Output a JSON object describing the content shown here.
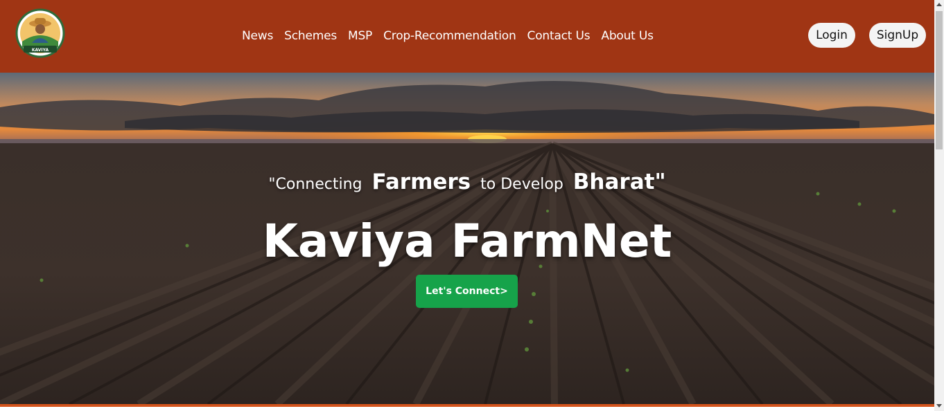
{
  "brand": {
    "logo_text": "KAVIYA"
  },
  "nav": {
    "links": [
      {
        "label": "News"
      },
      {
        "label": "Schemes"
      },
      {
        "label": "MSP"
      },
      {
        "label": "Crop-Recommendation"
      },
      {
        "label": "Contact Us"
      },
      {
        "label": "About Us"
      }
    ],
    "login_label": "Login",
    "signup_label": "SignUp"
  },
  "hero": {
    "tagline_part1": "\"Connecting",
    "tagline_part2": "Farmers",
    "tagline_part3": "to Develop",
    "tagline_part4": "Bharat\"",
    "title": "Kaviya FarmNet",
    "cta_label": "Let's Connect>"
  },
  "colors": {
    "navbar_bg": "#a03514",
    "cta_bg": "#16a34a",
    "accent_bar": "#d4541c"
  }
}
